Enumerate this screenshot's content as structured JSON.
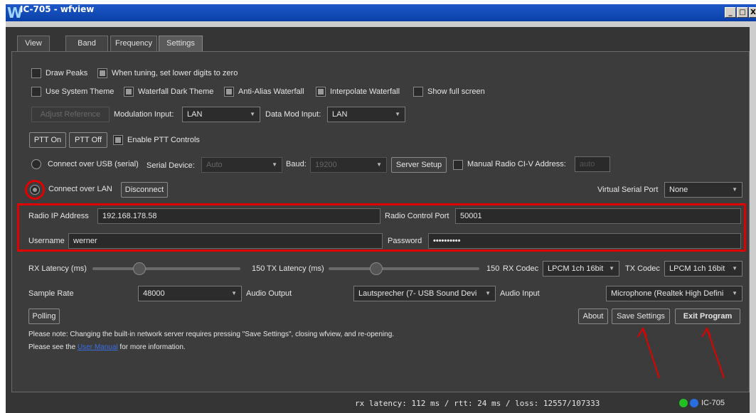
{
  "window": {
    "logo": "W",
    "title": "IC-705 - wfview",
    "min_label": "_",
    "max_label": "□",
    "close_label": "X"
  },
  "tabs": [
    {
      "label": "View"
    },
    {
      "label": "Band"
    },
    {
      "label": "Frequency"
    },
    {
      "label": "Settings",
      "active": true
    }
  ],
  "settings": {
    "draw_peaks": {
      "label": "Draw Peaks",
      "checked": false
    },
    "lower_digits": {
      "label": "When tuning, set lower digits to zero",
      "checked": true
    },
    "system_theme": {
      "label": "Use System Theme",
      "checked": false
    },
    "waterfall_dark": {
      "label": "Waterfall Dark Theme",
      "checked": true
    },
    "anti_alias": {
      "label": "Anti-Alias Waterfall",
      "checked": true
    },
    "interpolate": {
      "label": "Interpolate Waterfall",
      "checked": true
    },
    "full_screen": {
      "label": "Show full screen",
      "checked": false
    },
    "adjust_reference": "Adjust Reference",
    "modulation_input_label": "Modulation Input:",
    "modulation_input_value": "LAN",
    "data_mod_input_label": "Data Mod Input:",
    "data_mod_input_value": "LAN",
    "ptt_on": "PTT On",
    "ptt_off": "PTT Off",
    "enable_ptt": {
      "label": "Enable PTT Controls",
      "checked": true
    },
    "usb_radio_label": "Connect over USB (serial)",
    "serial_device_label": "Serial Device:",
    "serial_device_value": "Auto",
    "baud_label": "Baud:",
    "baud_value": "19200",
    "server_setup": "Server Setup",
    "manual_civ": {
      "label": "Manual Radio CI-V Address:",
      "checked": false
    },
    "civ_value": "auto",
    "lan_radio_label": "Connect over LAN",
    "disconnect": "Disconnect",
    "virtual_serial_label": "Virtual Serial Port",
    "virtual_serial_value": "None",
    "radio_ip_label": "Radio IP Address",
    "radio_ip_value": "192.168.178.58",
    "control_port_label": "Radio Control Port",
    "control_port_value": "50001",
    "username_label": "Username",
    "username_value": "werner",
    "password_label": "Password",
    "password_value": "••••••••••",
    "rx_latency_label": "RX Latency (ms)",
    "rx_latency_value": "150",
    "rx_latency_level": 0.3,
    "tx_latency_label": "TX Latency (ms)",
    "tx_latency_value": "150",
    "tx_latency_level": 0.3,
    "rx_codec_label": "RX Codec",
    "rx_codec_value": "LPCM 1ch 16bit",
    "tx_codec_label": "TX Codec",
    "tx_codec_value": "LPCM 1ch 16bit",
    "sample_rate_label": "Sample Rate",
    "sample_rate_value": "48000",
    "audio_output_label": "Audio Output",
    "audio_output_value": "Lautsprecher (7- USB Sound Devi",
    "audio_input_label": "Audio Input",
    "audio_input_value": "Microphone (Realtek High Defini",
    "polling": "Polling",
    "about": "About",
    "save_settings": "Save Settings",
    "exit_program": "Exit Program",
    "note_line1": "Please note: Changing  the built-in network server requires pressing \"Save Settings\", closing wfview, and re-opening.",
    "note_line2_prefix": "Please see the ",
    "note_line2_link": "User Manual",
    "note_line2_suffix": " for more information."
  },
  "status": {
    "text": "rx latency: 112 ms / rtt:  24 ms / loss: 12557/107333",
    "radio": "IC-705",
    "led1_color": "#22c022",
    "led2_color": "#2a6de0"
  },
  "annotations": {
    "color": "#e00000"
  }
}
